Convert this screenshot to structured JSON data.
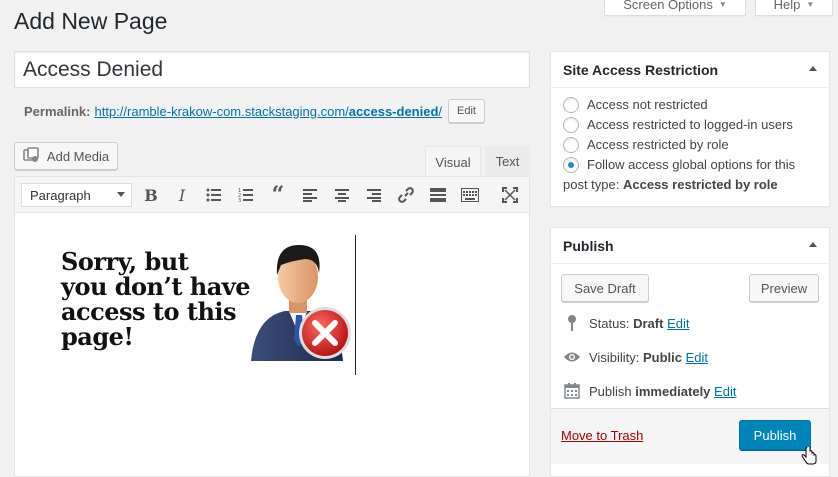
{
  "header": {
    "title": "Add New Page",
    "screen_options_label": "Screen Options",
    "help_label": "Help"
  },
  "title_field": {
    "value": "Access Denied"
  },
  "permalink": {
    "label": "Permalink:",
    "url_base": "http://ramble-krakow-com.stackstaging.com/",
    "url_slug": "access-denied",
    "url_trail": "/",
    "edit_label": "Edit"
  },
  "editor": {
    "add_media_label": "Add Media",
    "tabs": {
      "visual": "Visual",
      "text": "Text"
    },
    "format_select": "Paragraph",
    "toolbar_icons": [
      "bold-icon",
      "italic-icon",
      "bullet-list-icon",
      "numbered-list-icon",
      "blockquote-icon",
      "align-left-icon",
      "align-center-icon",
      "align-right-icon",
      "link-icon",
      "read-more-icon",
      "toolbar-toggle-icon",
      "fullscreen-icon"
    ],
    "content_image": {
      "text_lines": [
        "Sorry, but",
        "you don’t have",
        "access to this",
        "page!"
      ],
      "icon": "businessman-denied-icon"
    }
  },
  "restriction_box": {
    "title": "Site Access Restriction",
    "options": [
      {
        "label": "Access not restricted",
        "checked": false
      },
      {
        "label": "Access restricted to logged-in users",
        "checked": false
      },
      {
        "label": "Access restricted by role",
        "checked": false
      },
      {
        "label": "Follow access global options for this",
        "label_line2_prefix": "post type:",
        "label_line2_bold": "Access restricted by role",
        "checked": true
      }
    ]
  },
  "publish_box": {
    "title": "Publish",
    "save_draft_label": "Save Draft",
    "preview_label": "Preview",
    "status": {
      "label": "Status:",
      "value": "Draft",
      "edit": "Edit"
    },
    "visibility": {
      "label": "Visibility:",
      "value": "Public",
      "edit": "Edit"
    },
    "schedule": {
      "label": "Publish",
      "value": "immediately",
      "edit": "Edit"
    },
    "trash_label": "Move to Trash",
    "publish_label": "Publish"
  },
  "colors": {
    "primary": "#0085ba",
    "link": "#0073aa",
    "trash": "#a00000"
  }
}
